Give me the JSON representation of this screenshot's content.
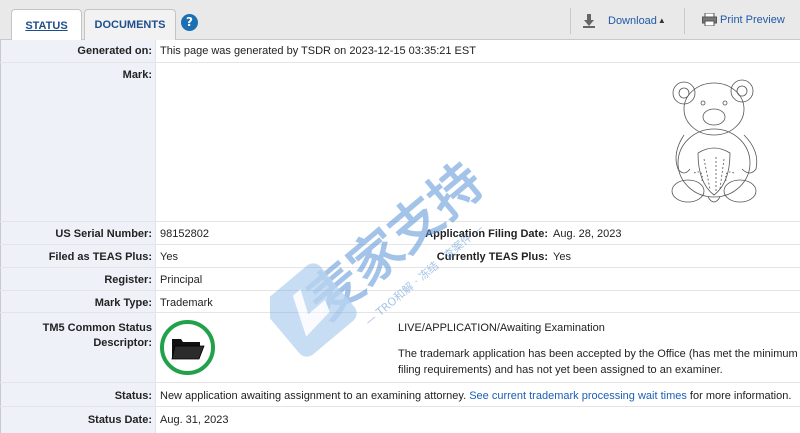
{
  "tabs": {
    "status": "STATUS",
    "documents": "DOCUMENTS",
    "help": "?"
  },
  "toolbar": {
    "download": "Download",
    "print": "Print Preview"
  },
  "generated_on": {
    "label": "Generated on:",
    "value": "This page was generated by TSDR on 2023-12-15 03:35:21 EST"
  },
  "mark": {
    "label": "Mark:"
  },
  "serial": {
    "label": "US Serial Number:",
    "value": "98152802"
  },
  "filing_date": {
    "label": "Application Filing Date:",
    "value": "Aug. 28, 2023"
  },
  "teas_plus": {
    "label": "Filed as TEAS Plus:",
    "value": "Yes"
  },
  "currently_teas": {
    "label": "Currently TEAS Plus:",
    "value": "Yes"
  },
  "register": {
    "label": "Register:",
    "value": "Principal"
  },
  "mark_type": {
    "label": "Mark Type:",
    "value": "Trademark"
  },
  "tm5": {
    "label_line1": "TM5 Common Status",
    "label_line2": "Descriptor:",
    "status_title": "LIVE/APPLICATION/Awaiting Examination",
    "desc_line1": "The trademark application has been accepted by the Office (has met the minimum",
    "desc_line2": "filing requirements) and has not yet been assigned to an examiner."
  },
  "status": {
    "label": "Status:",
    "value": "New application awaiting assignment to an examining attorney.",
    "link": "See current trademark processing wait times",
    "suffix": "for more information."
  },
  "status_date": {
    "label": "Status Date:",
    "value": "Aug. 31, 2023"
  },
  "watermark": {
    "main": "麦家支持",
    "sub": "— TRO和解 · 冻结 · 查案件 —"
  },
  "colors": {
    "accent": "#1f4e8c",
    "label_bg": "#eef1f8",
    "status_green": "#22a04a",
    "watermark": "#5b93d8"
  }
}
